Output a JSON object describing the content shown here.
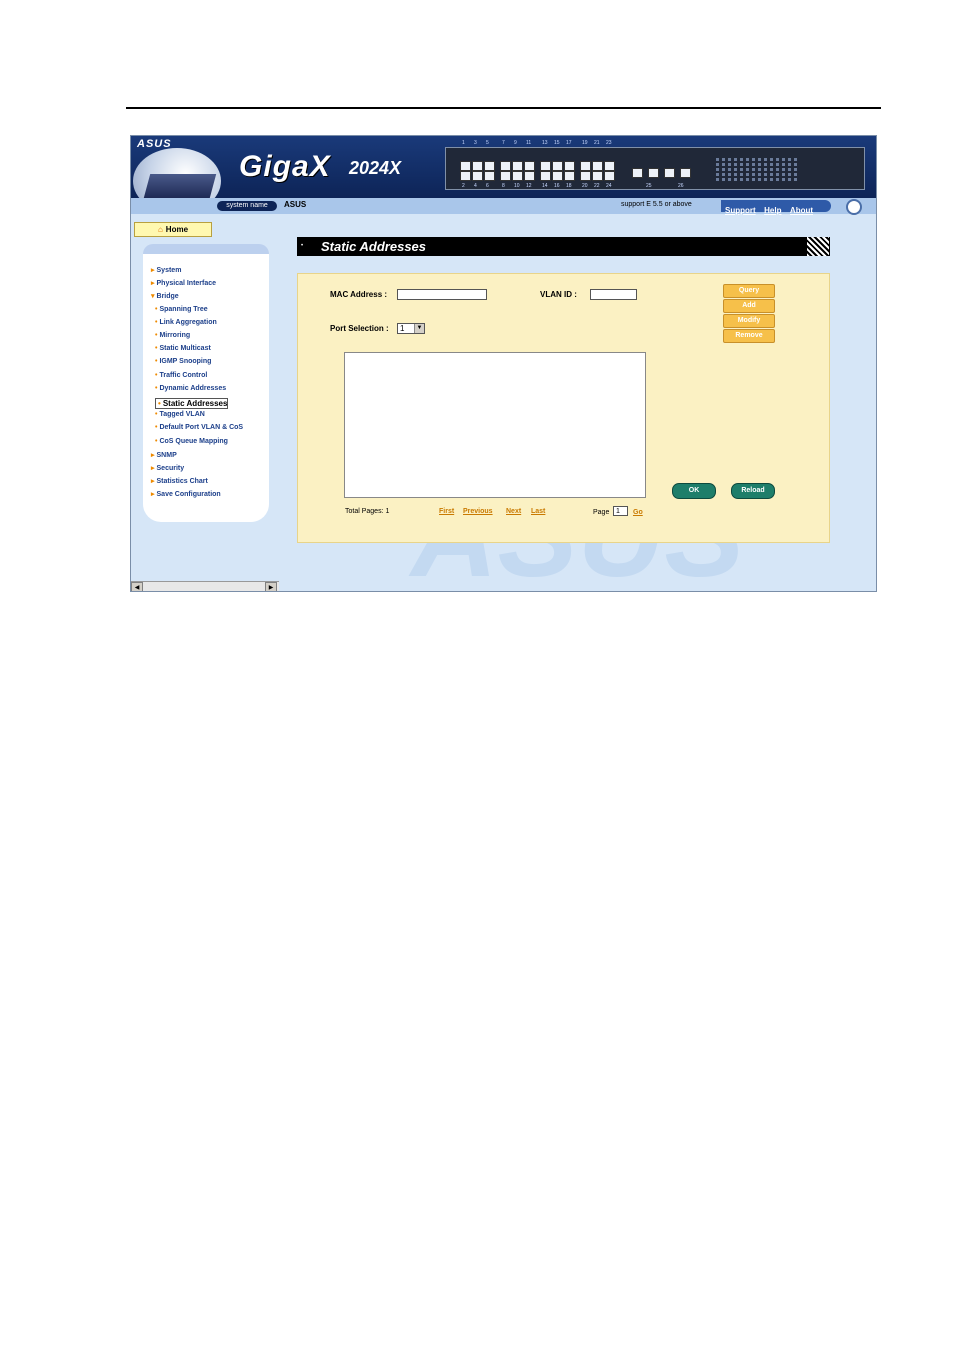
{
  "header": {
    "asus_logo": "ASUS",
    "brand": "GigaX",
    "model": "2024X",
    "port_numbers_top": [
      "1",
      "3",
      "5",
      "7",
      "9",
      "11",
      "13",
      "15",
      "17",
      "19",
      "21",
      "23"
    ],
    "port_numbers_bottom": [
      "2",
      "4",
      "6",
      "8",
      "10",
      "12",
      "14",
      "16",
      "18",
      "20",
      "22",
      "24"
    ],
    "uplink_labels": [
      "25",
      "26"
    ]
  },
  "sysbar": {
    "system_name_label": "system name",
    "system_name_value": "ASUS",
    "support_text": "support E 5.5 or above",
    "links": [
      "Support",
      "Help",
      "About"
    ]
  },
  "sidebar": {
    "home": "Home",
    "items": [
      {
        "label": "System",
        "level": 0
      },
      {
        "label": "Physical Interface",
        "level": 0
      },
      {
        "label": "Bridge",
        "level": 0
      },
      {
        "label": "Spanning Tree",
        "level": 1
      },
      {
        "label": "Link Aggregation",
        "level": 1
      },
      {
        "label": "Mirroring",
        "level": 1
      },
      {
        "label": "Static Multicast",
        "level": 1
      },
      {
        "label": "IGMP Snooping",
        "level": 1
      },
      {
        "label": "Traffic Control",
        "level": 1
      },
      {
        "label": "Dynamic Addresses",
        "level": 1
      },
      {
        "label": "Static Addresses",
        "level": 1,
        "selected": true
      },
      {
        "label": "Tagged VLAN",
        "level": 1
      },
      {
        "label": "Default Port VLAN & CoS",
        "level": 1
      },
      {
        "label": "CoS Queue Mapping",
        "level": 1
      },
      {
        "label": "SNMP",
        "level": 0
      },
      {
        "label": "Security",
        "level": 0
      },
      {
        "label": "Statistics Chart",
        "level": 0
      },
      {
        "label": "Save Configuration",
        "level": 0
      }
    ]
  },
  "page": {
    "title": "Static Addresses",
    "mac_label": "MAC Address :",
    "mac_value": "",
    "vlan_label": "VLAN ID :",
    "vlan_value": "",
    "port_label": "Port Selection :",
    "port_value": "1",
    "buttons": {
      "query": "Query",
      "add": "Add",
      "modify": "Modify",
      "remove": "Remove",
      "ok": "OK",
      "reload": "Reload"
    },
    "total_pages_label": "Total Pages: 1",
    "nav_links": {
      "first": "First",
      "previous": "Previous",
      "next": "Next",
      "last": "Last"
    },
    "page_label": "Page",
    "page_value": "1",
    "go": "Go"
  },
  "colors": {
    "header": "#0d2457",
    "panel": "#fbf1c3",
    "orange_button": "#f6c04a",
    "green_button": "#1e7e6a",
    "link": "#1c3f8a"
  }
}
